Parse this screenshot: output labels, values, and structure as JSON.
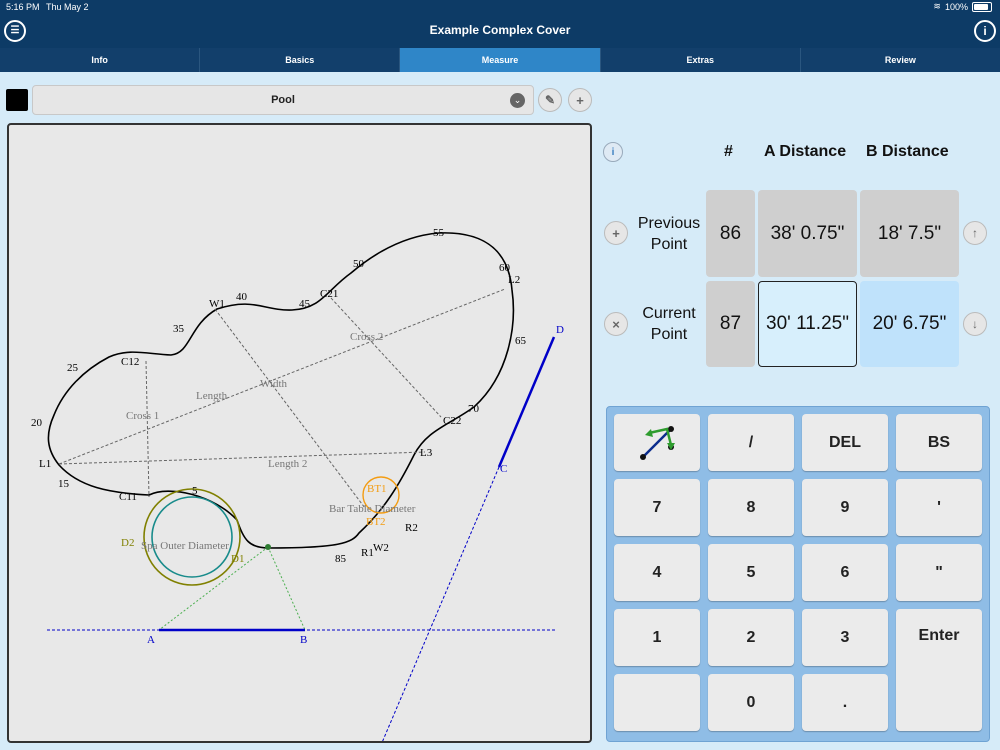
{
  "status": {
    "time": "5:16 PM",
    "date": "Thu May 2",
    "battery": "100%"
  },
  "nav": {
    "title": "Example Complex Cover",
    "menu_icon": "list-icon",
    "info_icon": "info-icon"
  },
  "tabs": [
    {
      "label": "Info",
      "active": false
    },
    {
      "label": "Basics",
      "active": false
    },
    {
      "label": "Measure",
      "active": true
    },
    {
      "label": "Extras",
      "active": false
    },
    {
      "label": "Review",
      "active": false
    }
  ],
  "toolbar": {
    "color": "#000000",
    "select_value": "Pool"
  },
  "drawing": {
    "curve_labels": [
      "55",
      "60",
      "L2",
      "50",
      "C21",
      "45",
      "40",
      "W1",
      "35",
      "65",
      "C12",
      "25",
      "Cross 2",
      "Width",
      "Length",
      "70",
      "C22",
      "20",
      "Cross 1",
      "L3",
      "L1",
      "Length 2",
      "15",
      "C11",
      "5",
      "Bar Table Diameter",
      "BT1",
      "BT2",
      "R2",
      "W2",
      "R1",
      "85",
      "D1",
      "D2",
      "Spa Outer Diameter",
      "A",
      "B",
      "C",
      "D"
    ],
    "accent_colors": {
      "outline": "#000000",
      "spa_outer": "#808000",
      "spa_inner": "#188b8b",
      "bar_table": "#f39c12",
      "baseline": "#0000c8",
      "guide": "#4caf50"
    }
  },
  "table": {
    "headers": {
      "num": "#",
      "a": "A Distance",
      "b": "B Distance"
    },
    "previous": {
      "label": "Previous Point",
      "num": "86",
      "a": "38' 0.75\"",
      "b": "18' 7.5\""
    },
    "current": {
      "label": "Current Point",
      "num": "87",
      "a": "30' 11.25\"",
      "b": "20' 6.75\""
    }
  },
  "keypad": {
    "keys": [
      "/",
      "DEL",
      "BS",
      "7",
      "8",
      "9",
      "'",
      "4",
      "5",
      "6",
      "\"",
      "1",
      "2",
      "3",
      "Enter",
      "0",
      "."
    ]
  },
  "colors": {
    "nav": "#0d3b66",
    "tab_active": "#2f86c8",
    "current_a_bg": "#d7effc",
    "current_b_bg": "#bfe2fb",
    "keypad_bg": "#8fbde6"
  }
}
